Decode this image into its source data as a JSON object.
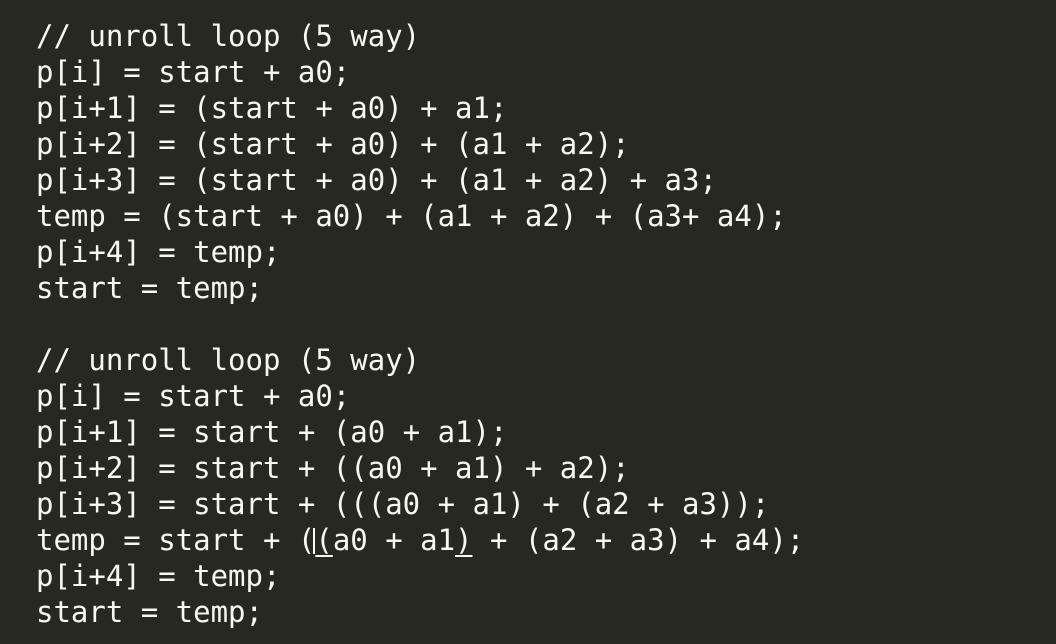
{
  "editor": {
    "block1": [
      "// unroll loop (5 way)",
      "p[i] = start + a0;",
      "p[i+1] = (start + a0) + a1;",
      "p[i+2] = (start + a0) + (a1 + a2);",
      "p[i+3] = (start + a0) + (a1 + a2) + a3;",
      "temp = (start + a0) + (a1 + a2) + (a3+ a4);",
      "p[i+4] = temp;",
      "start = temp;"
    ],
    "block2": [
      "// unroll loop (5 way)",
      "p[i] = start + a0;",
      "p[i+1] = start + (a0 + a1);",
      "p[i+2] = start + ((a0 + a1) + a2);",
      "p[i+3] = start + (((a0 + a1) + (a2 + a3));"
    ],
    "cursor_line": {
      "before": "temp = start + (",
      "bracket_open": "(",
      "middle": "a0 + a1",
      "bracket_close": ")",
      "after": " + (a2 + a3) + a4);"
    },
    "block2_tail": [
      "p[i+4] = temp;",
      "start = temp;"
    ]
  },
  "colors": {
    "background": "#272822",
    "text": "#f8f8f2"
  }
}
